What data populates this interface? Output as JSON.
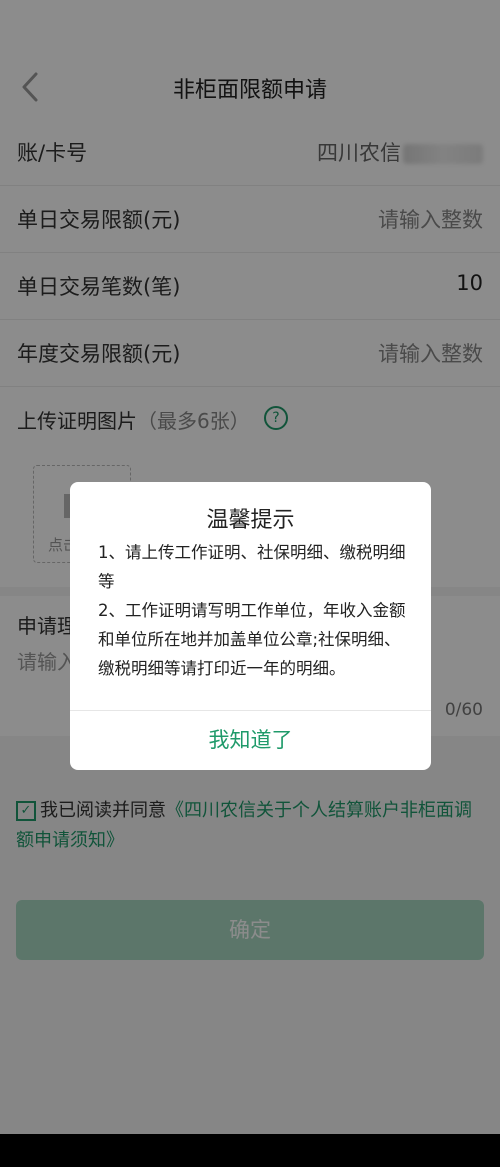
{
  "nav": {
    "title": "非柜面限额申请"
  },
  "form": {
    "rows": [
      {
        "label": "账/卡号",
        "value": "四川农信"
      },
      {
        "label": "单日交易限额(元)",
        "value": "请输入整数"
      },
      {
        "label": "单日交易笔数(笔)",
        "value": "10"
      },
      {
        "label": "年度交易限额(元)",
        "value": "请输入整数"
      }
    ]
  },
  "upload": {
    "title": "上传证明图片",
    "subtitle": "（最多6张）",
    "box_tip": "点击"
  },
  "reason": {
    "title": "申请理",
    "placeholder": "请输入",
    "counter": "0/60"
  },
  "agreement": {
    "prefix": "我已阅读并同意",
    "link": "《四川农信关于个人结算账户非柜面调额申请须知》"
  },
  "confirm_label": "确定",
  "dialog": {
    "title": "温馨提示",
    "line1": "1、请上传工作证明、社保明细、缴税明细等",
    "line2": "2、工作证明请写明工作单位，年收入金额和单位所在地并加盖单位公章;社保明细、缴税明细等请打印近一年的明细。",
    "button": "我知道了"
  },
  "colors": {
    "accent": "#1f9a6a",
    "confirm_disabled": "#a8d8c2"
  }
}
